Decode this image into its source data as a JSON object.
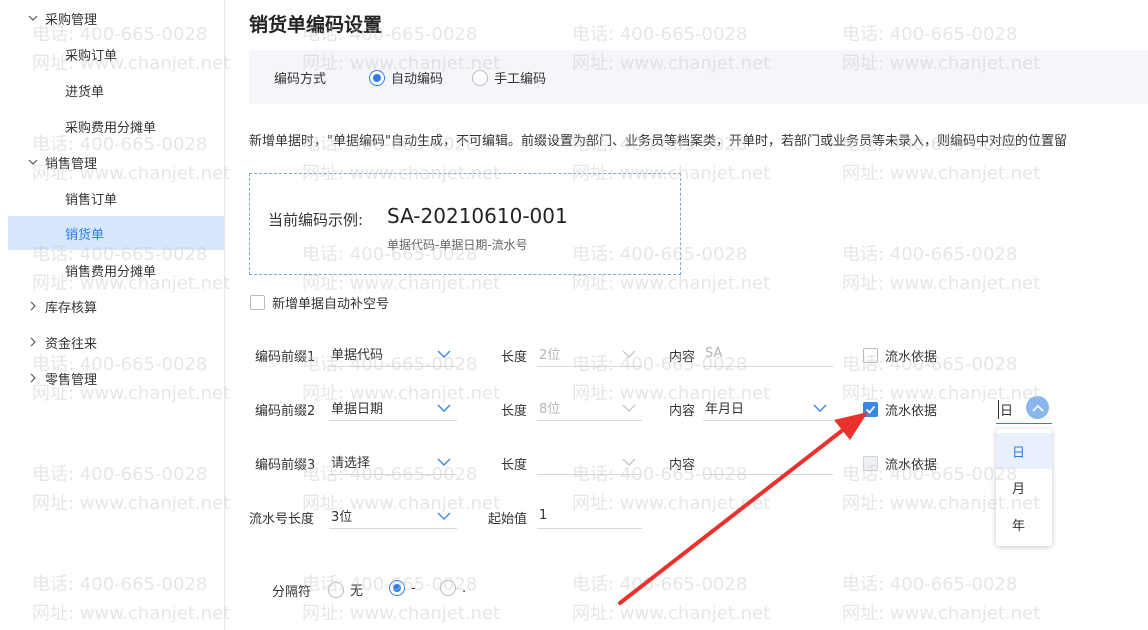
{
  "sidebar": {
    "groups": [
      {
        "label": "采购管理",
        "expanded": true
      },
      {
        "label": "销售管理",
        "expanded": true
      },
      {
        "label": "库存核算",
        "expanded": false
      },
      {
        "label": "资金往来",
        "expanded": false
      },
      {
        "label": "零售管理",
        "expanded": false
      }
    ],
    "items": {
      "purchase_order": "采购订单",
      "purchase_receipt": "进货单",
      "purchase_cost": "采购费用分摊单",
      "sales_order": "销售订单",
      "sales_delivery": "销货单",
      "sales_cost": "销售费用分摊单"
    },
    "active": "销货单"
  },
  "page": {
    "title": "销货单编码设置",
    "mode_label": "编码方式",
    "mode_auto": "自动编码",
    "mode_manual": "手工编码",
    "mode_selected": "auto",
    "description": "新增单据时，\"单据编码\"自动生成，不可编辑。前缀设置为部门、业务员等档案类，开单时，若部门或业务员等未录入，则编码中对应的位置留",
    "example_prefix": "当前编码示例:",
    "example_code": "SA-20210610-001",
    "example_sub": "单据代码-单据日期-流水号",
    "autofill_label": "新增单据自动补空号",
    "autofill_checked": false
  },
  "prefixes": [
    {
      "label": "编码前缀1",
      "type": "单据代码",
      "length_label": "长度",
      "length": "2位",
      "length_disabled": true,
      "content_label": "内容",
      "content": "SA",
      "content_disabled": true,
      "serial_label": "流水依据",
      "serial_checked": false
    },
    {
      "label": "编码前缀2",
      "type": "单据日期",
      "length_label": "长度",
      "length": "8位",
      "length_disabled": true,
      "content_label": "内容",
      "content": "年月日",
      "content_disabled": false,
      "serial_label": "流水依据",
      "serial_checked": true
    },
    {
      "label": "编码前缀3",
      "type": "请选择",
      "length_label": "长度",
      "length": "",
      "length_disabled": true,
      "content_label": "内容",
      "content": "",
      "content_disabled": true,
      "serial_label": "流水依据",
      "serial_checked": false
    }
  ],
  "serial": {
    "length_label": "流水号长度",
    "length": "3位",
    "start_label": "起始值",
    "start": "1"
  },
  "separator": {
    "label": "分隔符",
    "options": [
      "无",
      "-",
      "."
    ],
    "selected": "-"
  },
  "cycle": {
    "value": "日",
    "options": [
      "日",
      "月",
      "年"
    ],
    "selected": "日"
  },
  "watermark": {
    "phone": "电话: 400-665-0028",
    "site": "网址: www.chanjet.net"
  },
  "colors": {
    "accent": "#2d7de8",
    "active_bg": "#d6e6fb",
    "annotation_arrow": "#e8322b"
  }
}
